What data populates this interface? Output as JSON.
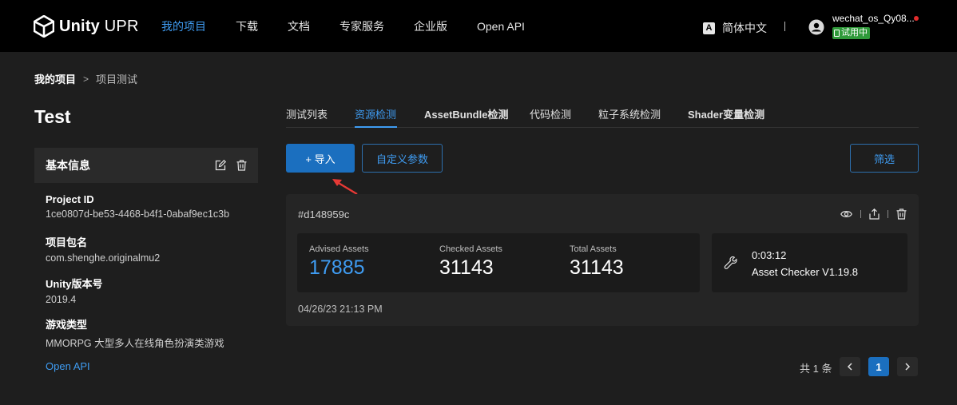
{
  "brand": {
    "name_bold": "Unity",
    "name_rest": " UPR"
  },
  "nav": {
    "items": [
      {
        "label": "我的项目",
        "active": true
      },
      {
        "label": "下载",
        "active": false
      },
      {
        "label": "文档",
        "active": false
      },
      {
        "label": "专家服务",
        "active": false
      },
      {
        "label": "企业版",
        "active": false
      },
      {
        "label": "Open API",
        "active": false
      }
    ]
  },
  "header": {
    "language_icon": "A",
    "language": "简体中文",
    "username": "wechat_os_Qy08...",
    "trial_badge": "试用中"
  },
  "breadcrumb": {
    "home": "我的项目",
    "separator": ">",
    "current": "项目测试"
  },
  "project": {
    "title": "Test",
    "info_title": "基本信息",
    "fields": [
      {
        "label": "Project ID",
        "value": "1ce0807d-be53-4468-b4f1-0abaf9ec1c3b"
      },
      {
        "label": "项目包名",
        "value": "com.shenghe.originalmu2"
      },
      {
        "label": "Unity版本号",
        "value": "2019.4"
      },
      {
        "label": "游戏类型",
        "value": "MMORPG 大型多人在线角色扮演类游戏"
      }
    ],
    "open_api": "Open API"
  },
  "tabs": [
    {
      "label": "测试列表",
      "active": false
    },
    {
      "label": "资源检测",
      "active": true
    },
    {
      "label": "AssetBundle检测",
      "active": false
    },
    {
      "label": "代码检测",
      "active": false
    },
    {
      "label": "粒子系统检测",
      "active": false
    },
    {
      "label": "Shader变量检测",
      "active": false
    }
  ],
  "toolbar": {
    "import": "+ 导入",
    "custom_params": "自定义参数",
    "filter": "筛选"
  },
  "result": {
    "id": "#d148959c",
    "stats": [
      {
        "label": "Advised Assets",
        "value": "17885"
      },
      {
        "label": "Checked Assets",
        "value": "31143"
      },
      {
        "label": "Total Assets",
        "value": "31143"
      }
    ],
    "duration": "0:03:12",
    "tool": "Asset Checker V1.19.8",
    "date": "04/26/23 21:13 PM"
  },
  "pagination": {
    "total": "共 1 条",
    "current": "1"
  },
  "colors": {
    "accent": "#3f9cf2",
    "primary_button": "#1b6fbf",
    "trial_green": "#2f9a3a",
    "alert_red": "#e22c2c"
  }
}
